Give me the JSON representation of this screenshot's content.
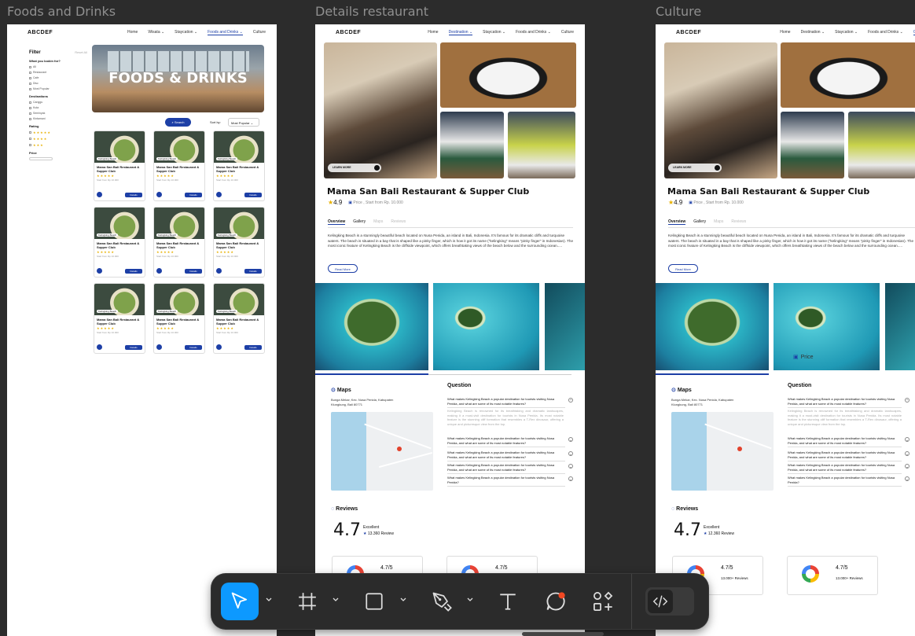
{
  "frames": {
    "foods_label": "Foods and Drinks",
    "details_label": "Details restaurant",
    "culture_label": "Culture"
  },
  "brand": "ABCDEF",
  "nav": {
    "foods": [
      "Home",
      "Wisata ⌄",
      "Staycation ⌄",
      "Foods and Drinks ⌄",
      "Culture"
    ],
    "details": [
      "Home",
      "Destination ⌄",
      "Staycation ⌄",
      "Foods and Drinks ⌄",
      "Culture"
    ]
  },
  "foods_page": {
    "filter_title": "Filter",
    "reset": "Reset All",
    "q_label": "What you lookin for?",
    "q_opts": [
      "All",
      "Restaurant",
      "Cafe",
      "Disc",
      "Most Popular"
    ],
    "dest_label": "Destinations",
    "dest_opts": [
      "Canggu",
      "Kuta",
      "Seminyak",
      "Kintamani"
    ],
    "rating_label": "Rating",
    "price_label": "Price",
    "hero_title": "FOODS & DRINKS",
    "search_btn": "Search",
    "sort_label": "Sort by:",
    "sort_value": "Most Popular",
    "card_badge": "Kelingking Beach",
    "card_name": "Mama San Bali Restaurant & Supper Club",
    "card_price": "Start from Rp 10.000",
    "card_btn": "Details",
    "cards": [
      1,
      2,
      3,
      4,
      5,
      6,
      7,
      8,
      9
    ]
  },
  "detail": {
    "learn_more": "LEARN MORE",
    "title": "Mama San Bali Restaurant & Supper Club",
    "rating": "4.9",
    "price": "Price , Start from Rp. 10.000",
    "tabs": [
      "Overview",
      "Gallery",
      "Maps",
      "Reviews"
    ],
    "overview": "Kelingking Beach is a stunningly beautiful beach located on Nusa Penida, an island in Bali, Indonesia. It's famous for its dramatic cliffs and turquoise waters. The beach is situated in a bay that is shaped like a pinky finger, which is how it got its name (\"kelingking\" means \"pinky finger\" in Indonesian). The most iconic feature of Kelingking Beach is the cliffside viewpoint, which offers breathtaking views of the beach below and the surrounding ocean.....",
    "read_more": "Read More",
    "maps_title": "Maps",
    "address": "Bunga Mekar, Kec. Nusa Penida, Kabupaten Klungkung, Bali 80771",
    "question_title": "Question",
    "q_open": "What makes Kelingking Beach a popular destination for tourists visiting Nusa Penida, and what are some of its most notable features?",
    "q_answer": "Kelingking Beach is renowned for its breathtaking and dramatic landscapes, making it a must-visit destination for tourists in Nusa Penida. Its most notable feature is the stunning cliff formation that resembles a T-Rex dinosaur, offering a unique and picturesque view from the top.",
    "q_items": [
      "What makes Kelingking Beach a popular destination for tourists visiting Nusa Penida, and what are some of its most notable features?",
      "What makes Kelingking Beach a popular destination for tourists visiting Nusa Penida, and what are some of its most notable features?",
      "What makes Kelingking Beach a popular destination for tourists visiting Nusa Penida, and what are some of its most notable features?",
      "What makes Kelingking Beach a popular destination for tourists visiting Nusa Penida?"
    ],
    "reviews_title": "Reviews",
    "score": "4.7",
    "score_label": "Excellent",
    "review_count_a": "13.360 Review",
    "review_count_b": "12.360 Review",
    "gcard_score": "4.7/5",
    "gcard_count": "13.000+ Reviews",
    "float_price": "Price"
  },
  "toolbar": {
    "move": "move-tool",
    "frame": "frame-tool",
    "shape": "rectangle-tool",
    "pen": "pen-tool",
    "text": "text-tool",
    "comment": "comment-tool",
    "actions": "actions-tool",
    "dev": "dev-mode-toggle",
    "accent": "#0d99ff"
  }
}
